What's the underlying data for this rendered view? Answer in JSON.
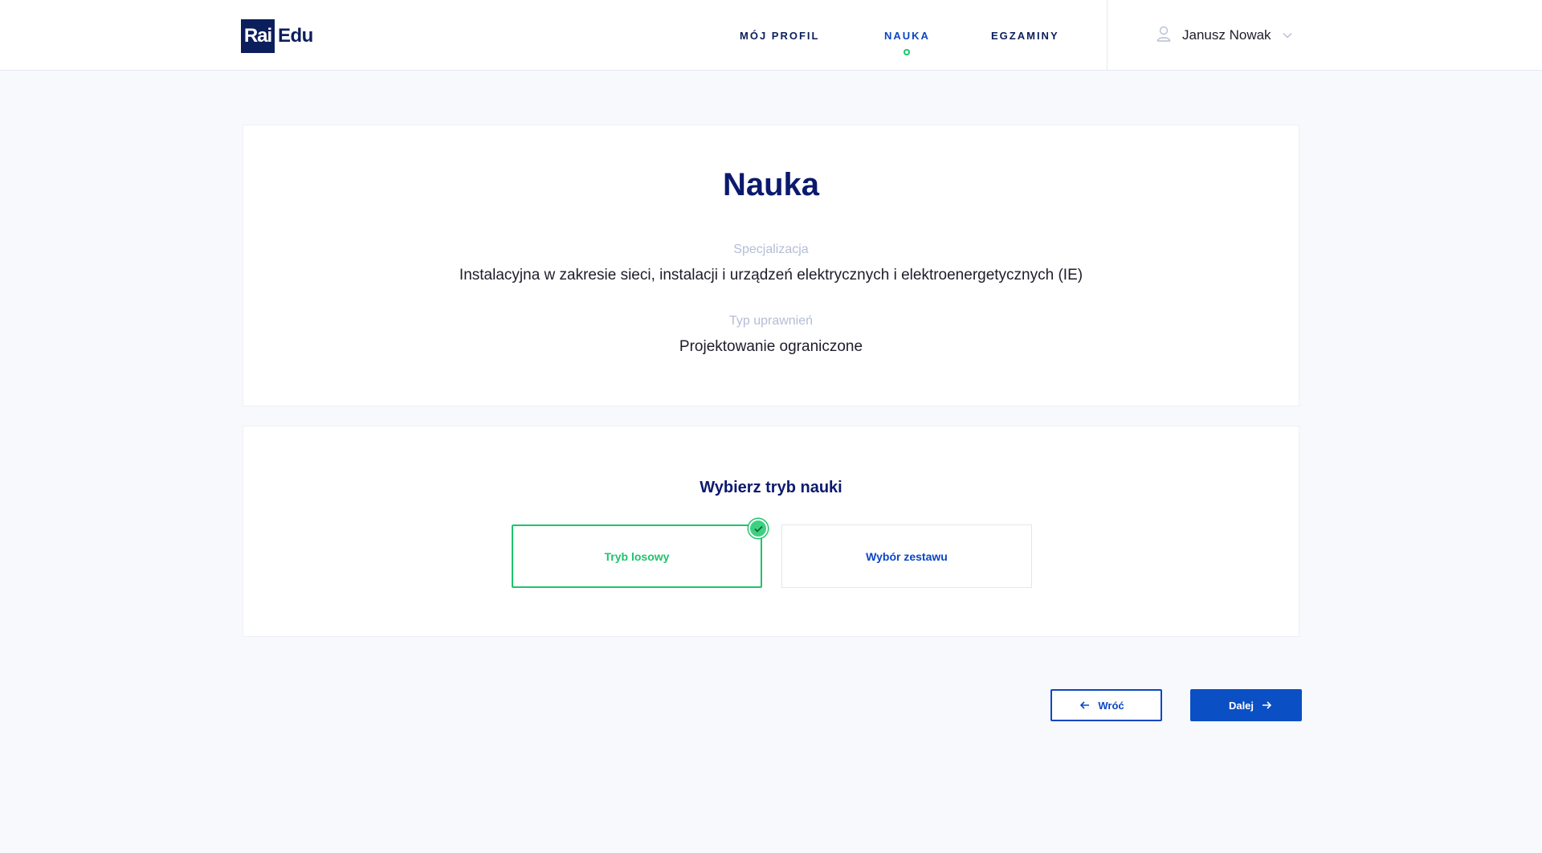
{
  "header": {
    "logo_rai": "Rai",
    "logo_edu": "Edu",
    "nav": {
      "profile": "MÓJ PROFIL",
      "learning": "NAUKA",
      "exams": "EGZAMINY"
    },
    "user_name": "Janusz Nowak",
    "active_color": "#0b46c4",
    "indicator_color": "#1ec46a"
  },
  "info": {
    "title": "Nauka",
    "specialization_label": "Specjalizacja",
    "specialization_value": "Instalacyjna w zakresie sieci, instalacji i urządzeń elektrycznych i elektroenergetycznych (IE)",
    "permission_label": "Typ uprawnień",
    "permission_value": "Projektowanie ograniczone"
  },
  "mode": {
    "title": "Wybierz tryb nauki",
    "options": [
      {
        "label": "Tryb losowy",
        "selected": true
      },
      {
        "label": "Wybór zestawu",
        "selected": false
      }
    ]
  },
  "actions": {
    "back_label": "Wróć",
    "next_label": "Dalej"
  },
  "icons": {
    "user": "user-icon",
    "dropdown": "chevron-down-icon",
    "selected": "check-icon",
    "back": "arrow-left-icon",
    "next": "arrow-right-icon"
  }
}
